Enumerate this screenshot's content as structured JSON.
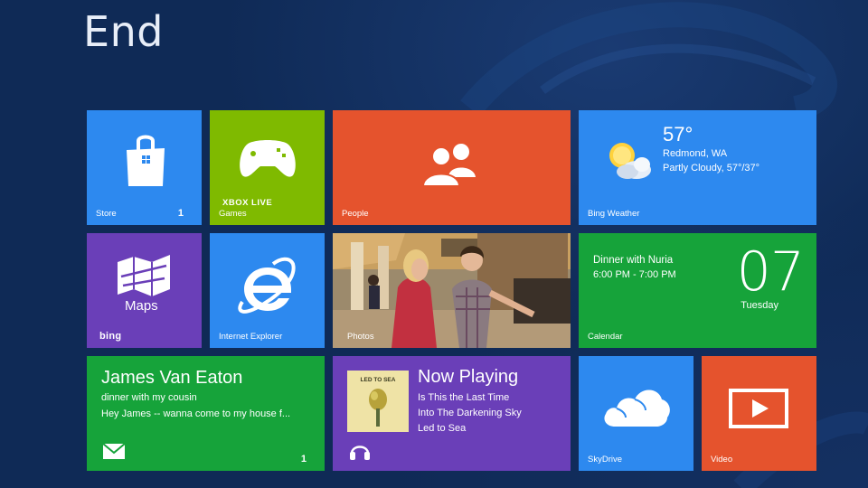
{
  "page": {
    "title": "End"
  },
  "tiles": {
    "store": {
      "label": "Store",
      "count": "1"
    },
    "games": {
      "label": "Games",
      "brand": "XBOX LIVE"
    },
    "people": {
      "label": "People"
    },
    "weather": {
      "label": "Bing Weather",
      "temp": "57°",
      "location": "Redmond, WA",
      "condition": "Partly Cloudy, 57°/37°"
    },
    "maps": {
      "label": "Maps",
      "brand": "bing"
    },
    "ie": {
      "label": "Internet Explorer"
    },
    "photos": {
      "label": "Photos"
    },
    "calendar": {
      "label": "Calendar",
      "event": "Dinner with Nuria",
      "time": "6:00 PM - 7:00 PM",
      "day": "07",
      "weekday": "Tuesday"
    },
    "mail": {
      "from": "James Van Eaton",
      "subject": "dinner with my cousin",
      "preview": "Hey James -- wanna come to my house f...",
      "count": "1"
    },
    "music": {
      "title": "Now Playing",
      "line1": "Is This the Last Time",
      "line2": "Into The Darkening Sky",
      "line3": "Led to Sea",
      "album_text": "LED TO SEA"
    },
    "skydrive": {
      "label": "SkyDrive"
    },
    "video": {
      "label": "Video"
    }
  },
  "colors": {
    "background": "#0f2a56",
    "blue": "#2d89ef",
    "green": "#16a33a",
    "lime": "#7fba00",
    "orange": "#e5532d",
    "purple": "#6a3fb8"
  },
  "icons": {
    "store": "shopping-bag-icon",
    "games": "game-controller-icon",
    "people": "people-icon",
    "weather": "sun-cloud-icon",
    "maps": "folded-map-icon",
    "ie": "internet-explorer-icon",
    "mail": "envelope-icon",
    "music": "headphones-icon",
    "skydrive": "cloud-icon",
    "video": "play-icon"
  }
}
